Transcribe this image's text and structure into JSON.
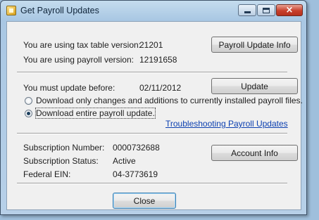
{
  "window": {
    "title": "Get Payroll Updates",
    "icon": "payroll-app-icon",
    "controls": {
      "minimize": "minimize-icon",
      "maximize": "maximize-icon",
      "close": "×"
    }
  },
  "versions": {
    "tax_table_label": "You are using tax table version:",
    "tax_table_value": "21201",
    "payroll_label": "You are using payroll version:",
    "payroll_value": "12191658",
    "info_button_label": "Payroll Update Info"
  },
  "update": {
    "deadline_label": "You must update before:",
    "deadline_value": "02/11/2012",
    "update_button_label": "Update",
    "options": [
      {
        "label": "Download only changes and additions to currently installed payroll files.",
        "selected": false
      },
      {
        "label": "Download entire payroll update.",
        "selected": true
      }
    ],
    "troubleshooting_link": "Troubleshooting Payroll Updates"
  },
  "subscription": {
    "number_label": "Subscription Number:",
    "number_value": "0000732688",
    "status_label": "Subscription Status:",
    "status_value": "Active",
    "ein_label": "Federal EIN:",
    "ein_value": "04-3773619",
    "account_button_label": "Account Info"
  },
  "footer": {
    "close_button_label": "Close"
  },
  "colors": {
    "link": "#0b3fb0",
    "default_button_border": "#3c7fb1",
    "title_close_button": "#c8402c",
    "desktop": "#9fbfdc"
  }
}
